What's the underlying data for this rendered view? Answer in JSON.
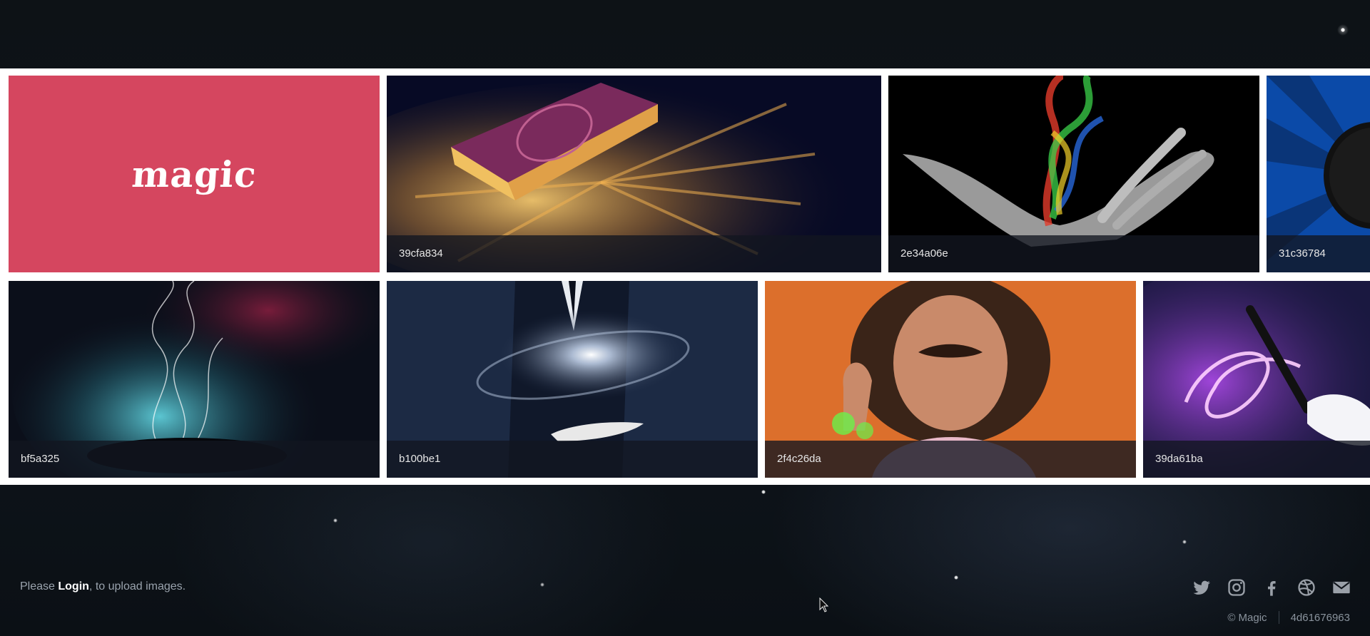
{
  "logo": {
    "text": "magic"
  },
  "gallery": {
    "row1": [
      {
        "id": "logo"
      },
      {
        "caption": "39cfa834"
      },
      {
        "caption": "2e34a06e"
      },
      {
        "caption": "31c36784"
      }
    ],
    "row2": [
      {
        "caption": "bf5a325"
      },
      {
        "caption": "b100be1"
      },
      {
        "caption": "2f4c26da"
      },
      {
        "caption": "39da61ba"
      }
    ]
  },
  "footer": {
    "prefix": "Please ",
    "login_label": "Login",
    "suffix": ", to upload images.",
    "copyright": "© Magic",
    "build_hash": "4d61676963",
    "social": [
      "twitter-icon",
      "instagram-icon",
      "facebook-icon",
      "dribbble-icon",
      "mail-icon"
    ]
  },
  "colors": {
    "logo_tile": "#d5465f",
    "caption_bar": "#121620"
  }
}
